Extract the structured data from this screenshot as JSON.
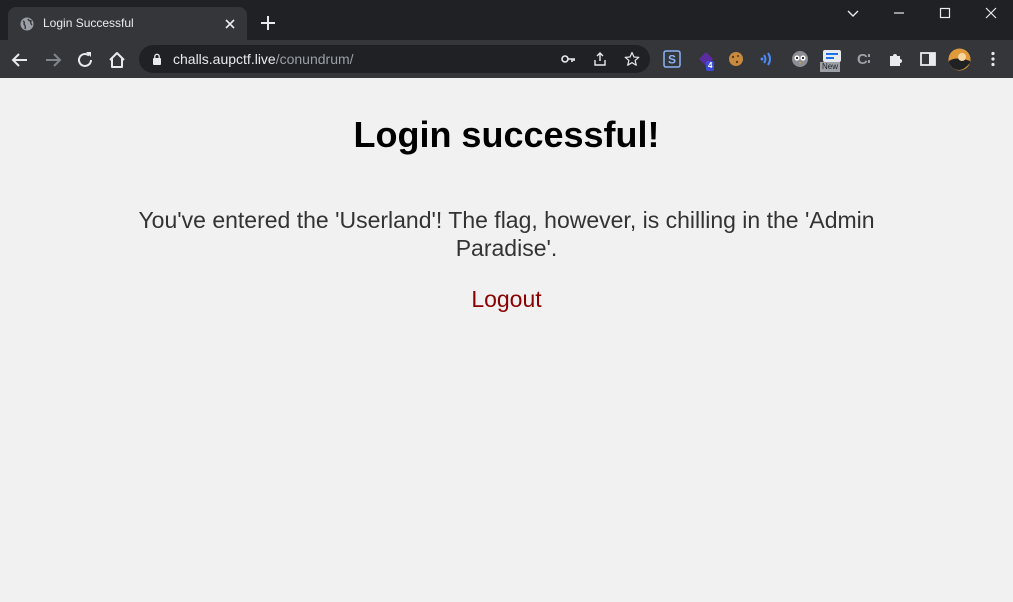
{
  "browser": {
    "tab_title": "Login Successful",
    "url_host": "challs.aupctf.live",
    "url_path": "/conundrum/",
    "extension_badges": {
      "badge_count": "4",
      "badge_new": "New"
    }
  },
  "page": {
    "heading": "Login successful!",
    "message": "You've entered the 'Userland'! The flag, however, is chilling in the 'Admin Paradise'.",
    "logout_label": "Logout"
  },
  "colors": {
    "page_background": "#f1f1f1",
    "logout_link": "#8b0000",
    "browser_frame": "#35363a"
  }
}
